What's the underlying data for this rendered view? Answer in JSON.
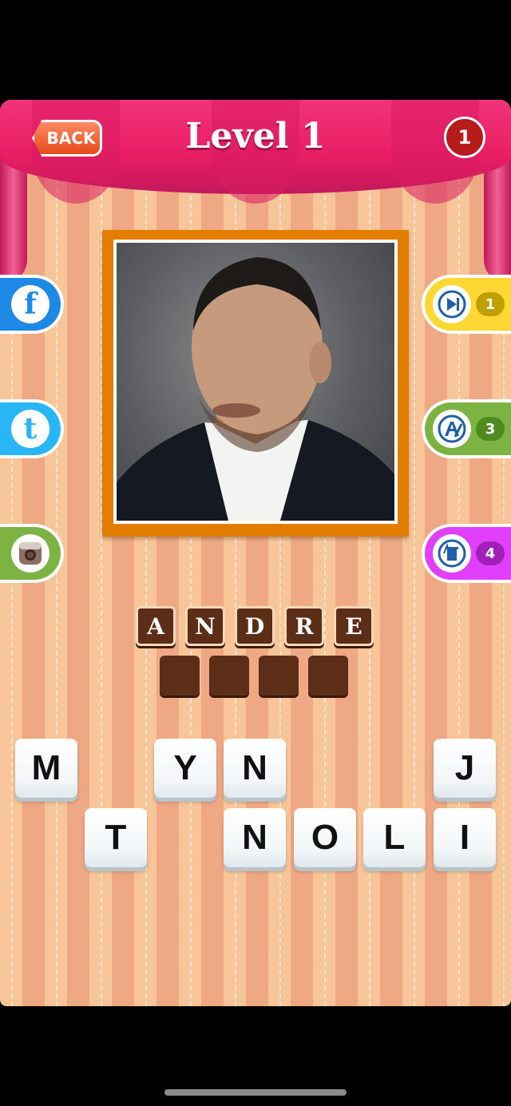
{
  "header": {
    "back_label": "BACK",
    "level_title": "Level 1",
    "coins": "1"
  },
  "social": [
    {
      "name": "facebook",
      "glyph": "f",
      "color": "#1e88e5"
    },
    {
      "name": "twitter",
      "glyph": "t",
      "color": "#29b6f6"
    },
    {
      "name": "instagram",
      "glyph": "",
      "color": "#7cb342"
    }
  ],
  "hints": [
    {
      "name": "skip",
      "count": "1",
      "color": "#fdd835",
      "pill": "#c0a000"
    },
    {
      "name": "reveal-letter",
      "count": "3",
      "color": "#7cb342",
      "pill": "#4f8a1e"
    },
    {
      "name": "remove-letters",
      "count": "4",
      "color": "#e040fb",
      "pill": "#a020b8"
    }
  ],
  "answer": {
    "row1": [
      "A",
      "N",
      "D",
      "R",
      "E"
    ],
    "row2": [
      "",
      "",
      "",
      ""
    ]
  },
  "tiles": {
    "row1": [
      "M",
      "Y",
      "N",
      "J"
    ],
    "row2": [
      "T",
      "N",
      "O",
      "L",
      "I"
    ]
  }
}
